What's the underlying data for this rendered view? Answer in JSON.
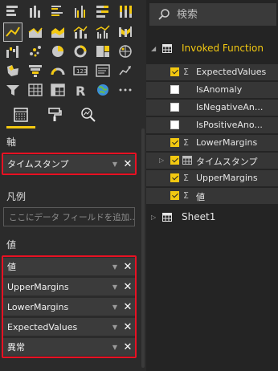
{
  "viz_pane": {
    "icons": [
      "stacked-bar-icon",
      "stacked-column-icon",
      "clustered-bar-icon",
      "clustered-column-icon",
      "100-bar-icon",
      "100-column-icon",
      "line-chart-icon",
      "area-chart-icon",
      "stacked-area-icon",
      "line-column-icon",
      "line-clustered-icon",
      "ribbon-chart-icon",
      "waterfall-icon",
      "scatter-icon",
      "pie-chart-icon",
      "donut-chart-icon",
      "treemap-icon",
      "map-icon",
      "filled-map-icon",
      "funnel-icon",
      "gauge-icon",
      "card-icon",
      "multirow-card-icon",
      "kpi-icon",
      "slicer-icon",
      "table-icon",
      "matrix-icon",
      "r-visual-icon",
      "globe-icon",
      "more-icon"
    ],
    "selected_icon": "line-chart-icon",
    "tabs": [
      "fields-tab",
      "format-tab",
      "analytics-tab"
    ],
    "active_tab": "fields-tab",
    "accent_color": "#f2c811",
    "highlight_color": "#e81123"
  },
  "axis": {
    "label": "軸",
    "fields": [
      "タイムスタンプ"
    ]
  },
  "legend": {
    "label": "凡例",
    "placeholder": "ここにデータ フィールドを追加..."
  },
  "values": {
    "label": "値",
    "fields": [
      "値",
      "UpperMargins",
      "LowerMargins",
      "ExpectedValues",
      "異常"
    ]
  },
  "fields_pane": {
    "search_placeholder": "検索",
    "tables": [
      {
        "name": "Invoked Function",
        "expanded": true,
        "fields": [
          {
            "label": "ExpectedValues",
            "checked": true,
            "sigma": true
          },
          {
            "label": "IsAnomaly",
            "checked": false,
            "sigma": false
          },
          {
            "label": "IsNegativeAn...",
            "checked": false,
            "sigma": false
          },
          {
            "label": "IsPositiveAno...",
            "checked": false,
            "sigma": false
          },
          {
            "label": "LowerMargins",
            "checked": true,
            "sigma": true
          },
          {
            "label": "タイムスタンプ",
            "checked": true,
            "sigma": false,
            "hierarchy": true
          },
          {
            "label": "UpperMargins",
            "checked": true,
            "sigma": true
          },
          {
            "label": "値",
            "checked": true,
            "sigma": true
          }
        ]
      },
      {
        "name": "Sheet1",
        "expanded": false,
        "fields": []
      }
    ]
  }
}
